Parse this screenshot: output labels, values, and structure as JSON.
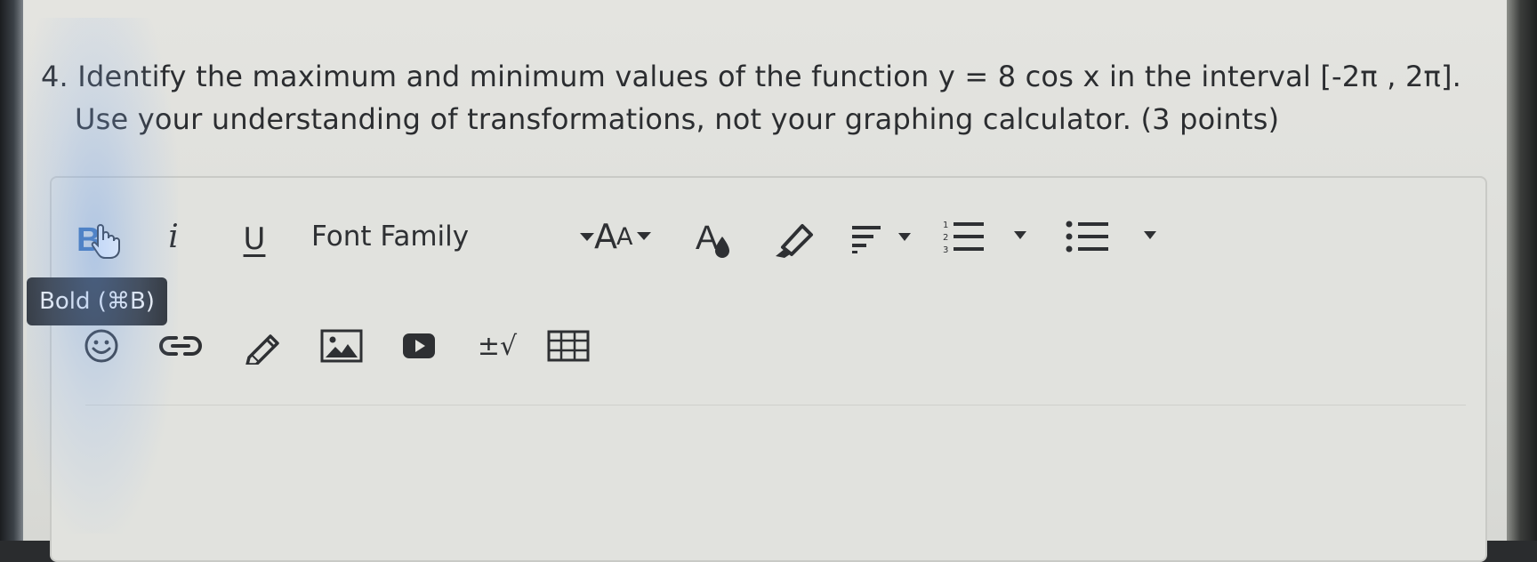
{
  "question": {
    "line1": "4. Identify the maximum and minimum values of the function y = 8 cos x in the interval [-2π , 2π].",
    "line2": "Use your understanding of transformations, not your graphing calculator. (3 points)"
  },
  "toolbar": {
    "bold_icon": "bold-icon",
    "italic_label": "i",
    "underline_label": "U",
    "font_family_label": "Font Family",
    "font_size_label_large": "A",
    "font_size_label_small": "A",
    "tooltip": "Bold (⌘B)",
    "equation_label": "±√"
  },
  "colors": {
    "tooltip_bg": "#2f3236",
    "icon": "#2e3033",
    "text": "#2b2d30"
  }
}
